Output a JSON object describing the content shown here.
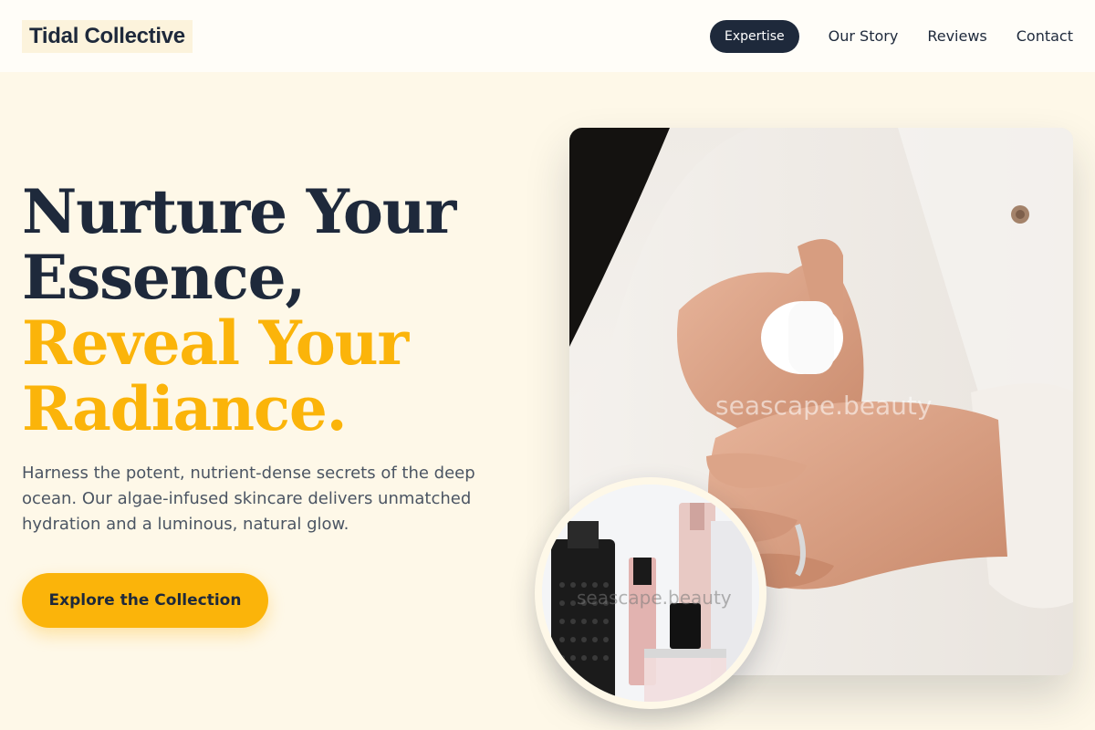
{
  "header": {
    "brand": "Tidal Collective",
    "nav": [
      {
        "label": "Expertise",
        "active": true
      },
      {
        "label": "Our Story"
      },
      {
        "label": "Reviews"
      },
      {
        "label": "Contact"
      }
    ]
  },
  "hero": {
    "title_lines": [
      "Nurture Your",
      "Essence,",
      "Reveal Your",
      "Radiance."
    ],
    "description": "Harness the potent, nutrient-dense secrets of the deep ocean. Our algae-infused skincare delivers unmatched hydration and a luminous, natural glow.",
    "cta_label": "Explore the Collection"
  },
  "images": {
    "main_watermark": "seascape.beauty",
    "circle_watermark": "seascape.beauty"
  },
  "colors": {
    "navy": "#1e293b",
    "accent": "#fbb40a",
    "background": "#fef8e8",
    "header_bg": "#fffdf8"
  }
}
